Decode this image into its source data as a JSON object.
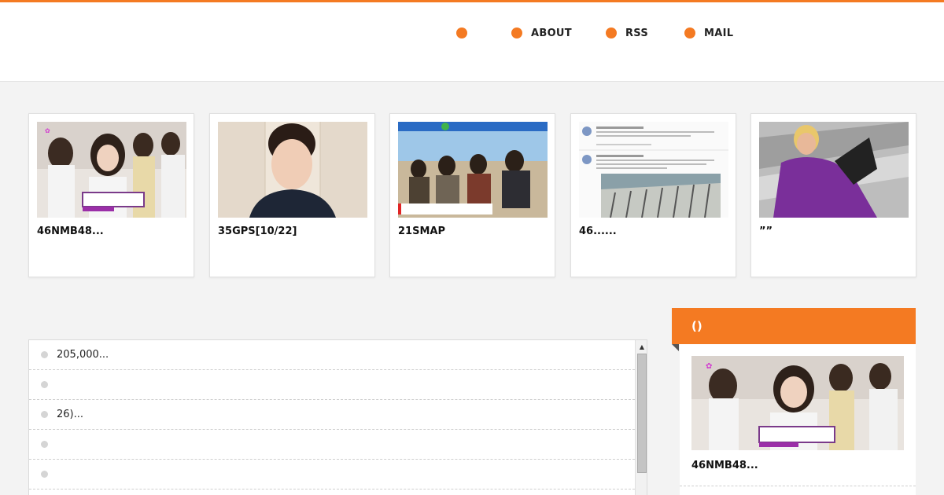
{
  "brand": {
    "accent_color": "#f47a22"
  },
  "nav": {
    "items": [
      {
        "label": ""
      },
      {
        "label": "ABOUT"
      },
      {
        "label": "RSS"
      },
      {
        "label": "MAIL"
      }
    ]
  },
  "cards": [
    {
      "title": "46NMB48..."
    },
    {
      "title": "35GPS[10/22]"
    },
    {
      "title": "21SMAP"
    },
    {
      "title": "46......"
    },
    {
      "title": "””"
    }
  ],
  "list": {
    "items": [
      {
        "text": "205,000..."
      },
      {
        "text": ""
      },
      {
        "text": "26)..."
      },
      {
        "text": ""
      },
      {
        "text": ""
      }
    ],
    "scroll_up_icon": "triangle-up"
  },
  "widget": {
    "title": "()",
    "item_title": "46NMB48..."
  }
}
